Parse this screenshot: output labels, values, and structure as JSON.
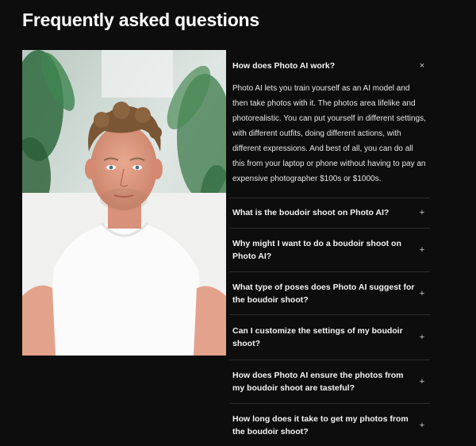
{
  "page": {
    "title": "Frequently asked questions"
  },
  "photo": {
    "subject": "portrait-photo"
  },
  "faq": {
    "items": [
      {
        "question": "How does Photo AI work?",
        "answer": "Photo AI lets you train yourself as an AI model and then take photos with it. The photos area lifelike and photorealistic. You can put yourself in different settings, with different outfits, doing different actions, with different expressions. And best of all, you can do all this from your laptop or phone without having to pay an expensive photographer $100s or $1000s.",
        "icon": "×",
        "expanded": true
      },
      {
        "question": "What is the boudoir shoot on Photo AI?",
        "icon": "+"
      },
      {
        "question": "Why might I want to do a boudoir shoot on Photo AI?",
        "icon": "+"
      },
      {
        "question": "What type of poses does Photo AI suggest for the boudoir shoot?",
        "icon": "+"
      },
      {
        "question": "Can I customize the settings of my boudoir shoot?",
        "icon": "+"
      },
      {
        "question": "How does Photo AI ensure the photos from my boudoir shoot are tasteful?",
        "icon": "+"
      },
      {
        "question": "How long does it take to get my photos from the boudoir shoot?",
        "icon": "+"
      }
    ]
  }
}
